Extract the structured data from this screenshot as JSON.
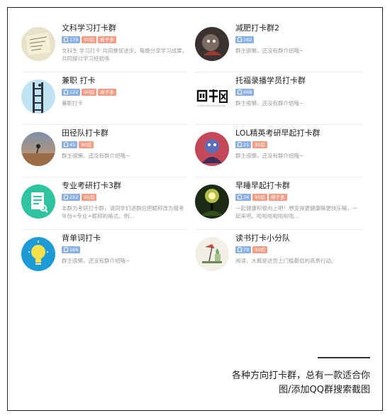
{
  "left_groups": [
    {
      "title": "文科学习打卡群",
      "members": "179",
      "age": "90后",
      "category": "妹子多",
      "desc": "文科生 学习打卡 共同督促进步。每晚分享学习成果，共同探讨学习经验咯",
      "icon": "paper-sketch-avatar"
    },
    {
      "title": "兼职 打卡",
      "members": "122",
      "age": "90后",
      "category": "妹子多",
      "desc": "兼职打卡",
      "icon": "ladder-sky-avatar"
    },
    {
      "title": "田径队打卡群",
      "members": "45",
      "age": "90后",
      "category": "",
      "desc": "群主很懒，还没有群介绍哦~",
      "icon": "sunset-runner-avatar"
    },
    {
      "title": "专业考研打卡3群",
      "members": "222",
      "age": "90后",
      "category": "",
      "desc": "本群为考研打卡群，请同学们进群后把昵称改为报考年份+专业+昵称的格式。例...",
      "icon": "document-search-avatar"
    },
    {
      "title": "背单词打卡",
      "members": "166",
      "age": "",
      "category": "",
      "desc": "群主很懒，还没有群介绍哦~",
      "icon": "lightbulb-avatar"
    }
  ],
  "right_groups": [
    {
      "title": "减肥打卡群2",
      "members": "162",
      "age": "",
      "category": "",
      "desc": "群主很懒，还没有群介绍哦~",
      "icon": "dark-character-avatar"
    },
    {
      "title": "托福录播学员打卡群",
      "members": "468",
      "age": "",
      "category": "",
      "desc": "群主很懒，还没有群介绍哦~",
      "icon": "langbo-logo-avatar"
    },
    {
      "title": "LOL精英考研早起打卡群",
      "members": "21",
      "age": "90后",
      "category": "",
      "desc": "群主很懒，还没有群介绍哦~",
      "icon": "game-character-avatar"
    },
    {
      "title": "早睡早起打卡群",
      "members": "34",
      "age": "90后",
      "category": "妹子多",
      "desc": "一起健康积极向上吧！想变得更健康嘛更快乐嘛，一起来吧。啦啦啦啦啦啦啦...",
      "icon": "night-glow-avatar"
    },
    {
      "title": "读书打卡小分队",
      "members": "79",
      "age": "90后",
      "category": "",
      "desc": "阅读，大概是这世上门槛最低的高贵行动。",
      "icon": "desk-lamp-avatar"
    }
  ],
  "caption": {
    "line1": "各种方向打卡群，总有一款适合你",
    "line2": "图/添加QQ群搜索截图"
  },
  "colors": {
    "member_tag": "#8ab0e6",
    "age_tag": "#f49c85",
    "desc_text": "#999999"
  }
}
